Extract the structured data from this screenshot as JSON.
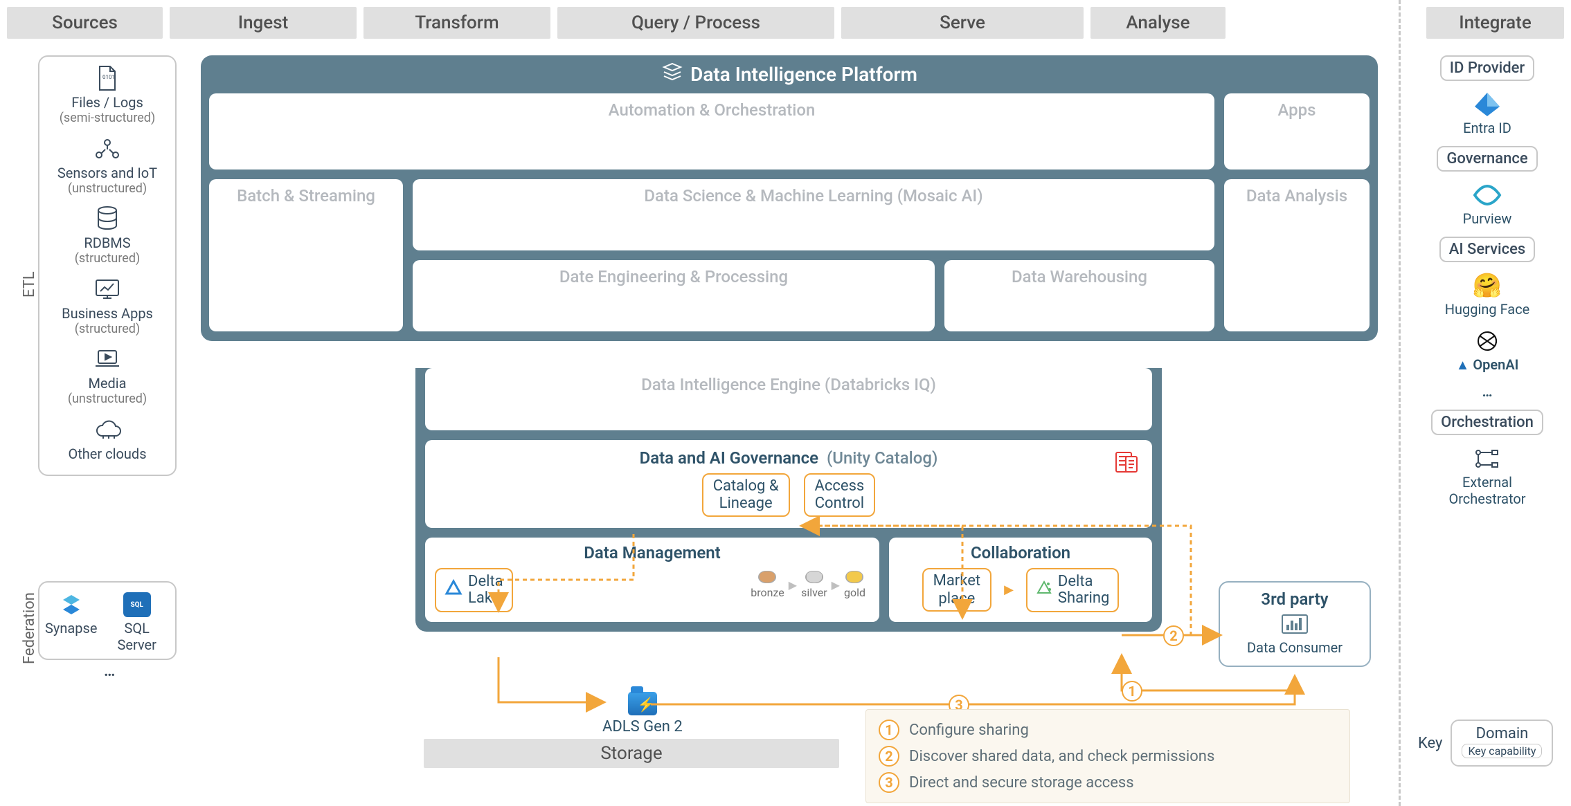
{
  "columns": {
    "sources": "Sources",
    "ingest": "Ingest",
    "transform": "Transform",
    "query": "Query / Process",
    "serve": "Serve",
    "analyse": "Analyse",
    "integrate": "Integrate"
  },
  "vertical_labels": {
    "etl": "ETL",
    "federation": "Federation"
  },
  "sources": {
    "items": [
      {
        "title": "Files / Logs",
        "sub": "(semi-structured)",
        "icon": "file-icon"
      },
      {
        "title": "Sensors and IoT",
        "sub": "(unstructured)",
        "icon": "iot-icon"
      },
      {
        "title": "RDBMS",
        "sub": "(structured)",
        "icon": "database-icon"
      },
      {
        "title": "Business Apps",
        "sub": "(structured)",
        "icon": "monitor-chart-icon"
      },
      {
        "title": "Media",
        "sub": "(unstructured)",
        "icon": "laptop-play-icon"
      },
      {
        "title": "Other clouds",
        "sub": "",
        "icon": "cloud-icon"
      }
    ]
  },
  "federation": {
    "items": [
      {
        "label": "Synapse",
        "icon": "synapse-icon"
      },
      {
        "label": "SQL Server",
        "icon": "sql-server-icon"
      }
    ],
    "more": "…"
  },
  "platform": {
    "title": "Data Intelligence Platform",
    "automation": "Automation & Orchestration",
    "apps": "Apps",
    "batch_streaming": "Batch & Streaming",
    "ds_ml": "Data Science & Machine Learning  (Mosaic AI)",
    "data_eng": "Date Engineering & Processing",
    "data_wh": "Data Warehousing",
    "data_analysis": "Data Analysis",
    "iq_engine": "Data Intelligence Engine  (Databricks IQ)",
    "governance": {
      "title": "Data and AI Governance",
      "suffix": "(Unity Catalog)",
      "catalog_lineage": "Catalog & Lineage",
      "access_control": "Access Control"
    },
    "data_mgmt": {
      "title": "Data Management",
      "delta_lake": "Delta Lake",
      "medallion": {
        "bronze": "bronze",
        "silver": "silver",
        "gold": "gold"
      }
    },
    "collaboration": {
      "title": "Collaboration",
      "marketplace": "Market place",
      "delta_sharing": "Delta Sharing"
    }
  },
  "storage": {
    "adls": "ADLS Gen 2",
    "bar": "Storage"
  },
  "third_party": {
    "title": "3rd party",
    "consumer": "Data Consumer"
  },
  "flow_steps": {
    "s1": "Configure sharing",
    "s2": "Discover shared data, and check permissions",
    "s3": "Direct and secure storage access",
    "n1": "1",
    "n2": "2",
    "n3": "3"
  },
  "integrate": {
    "id_provider": {
      "label": "ID Provider",
      "entra": "Entra ID"
    },
    "governance": {
      "label": "Governance",
      "purview": "Purview"
    },
    "ai_services": {
      "label": "AI Services",
      "hf": "Hugging Face",
      "openai": "OpenAI",
      "more": "…"
    },
    "orchestration": {
      "label": "Orchestration",
      "external": "External Orchestrator"
    }
  },
  "key": {
    "label": "Key",
    "domain": "Domain",
    "capability": "Key capability"
  },
  "colors": {
    "platform_bg": "#5f7f8f",
    "accent_orange": "#f2a63b",
    "header_grey": "#e0e0e0"
  }
}
